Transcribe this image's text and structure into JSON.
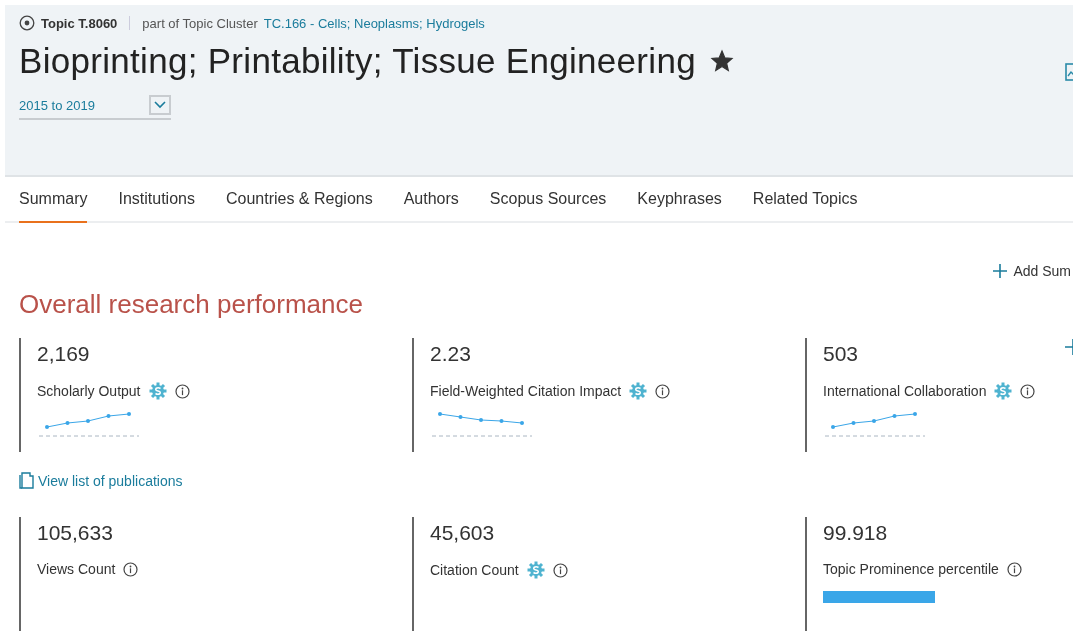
{
  "header": {
    "topic_label": "Topic T.8060",
    "cluster_prefix": "part of Topic Cluster",
    "cluster_link": "TC.166 - Cells; Neoplasms; Hydrogels",
    "title": "Bioprinting; Printability; Tissue Engineering",
    "starred": true,
    "period": "2015 to 2019"
  },
  "tabs": [
    {
      "label": "Summary",
      "selected": true
    },
    {
      "label": "Institutions",
      "selected": false
    },
    {
      "label": "Countries & Regions",
      "selected": false
    },
    {
      "label": "Authors",
      "selected": false
    },
    {
      "label": "Scopus Sources",
      "selected": false
    },
    {
      "label": "Keyphrases",
      "selected": false
    },
    {
      "label": "Related Topics",
      "selected": false
    }
  ],
  "add_summary": "Add Sum",
  "section_title": "Overall research performance",
  "metrics_top": [
    {
      "kind": "sparkline",
      "value": "2,169",
      "label": "Scholarly Output",
      "snowball": true
    },
    {
      "kind": "sparkline",
      "value": "2.23",
      "label": "Field-Weighted Citation Impact",
      "snowball": true
    },
    {
      "kind": "sparkline",
      "value": "503",
      "label": "International Collaboration",
      "snowball": true
    }
  ],
  "publications_link": "View list of publications",
  "metrics_bottom": [
    {
      "kind": "plain",
      "value": "105,633",
      "label": "Views Count",
      "snowball": false
    },
    {
      "kind": "plain",
      "value": "45,603",
      "label": "Citation Count",
      "snowball": true
    },
    {
      "kind": "bar",
      "value": "99.918",
      "label": "Topic Prominence percentile",
      "snowball": false,
      "level": 0.99918
    }
  ]
}
